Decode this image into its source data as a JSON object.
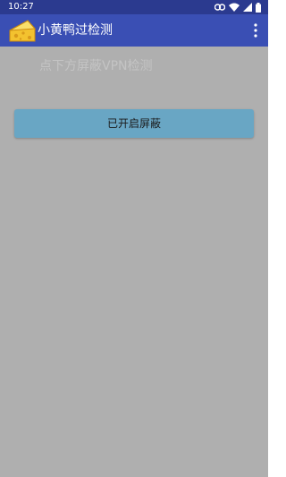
{
  "status_bar": {
    "time": "10:27",
    "icons": [
      "link-icon",
      "wifi-icon",
      "signal-icon",
      "battery-icon"
    ]
  },
  "app_bar": {
    "title": "小黄鸭过检测",
    "logo_icon": "cheese-icon",
    "menu_icon": "more-vertical-icon"
  },
  "main": {
    "hint_text": "点下方屏蔽VPN检测",
    "toggle_button_label": "已开启屏蔽"
  },
  "colors": {
    "status_bar": "#2b3a8f",
    "app_bar": "#3a4fb4",
    "background": "#afafaf",
    "button": "#69a6c4"
  }
}
